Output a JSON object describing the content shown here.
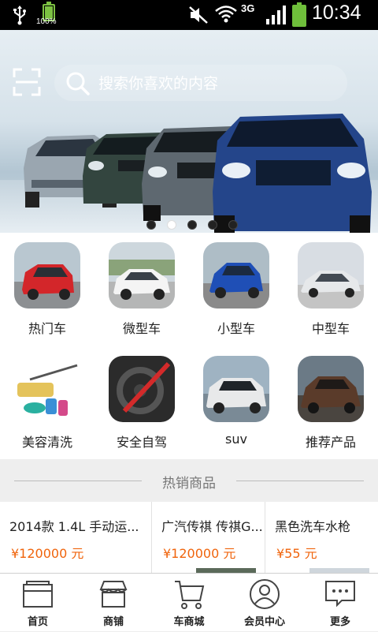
{
  "status_bar": {
    "battery_small_label": "100%",
    "network": "3G",
    "time": "10:34"
  },
  "banner": {
    "search_placeholder": "搜索你喜欢的内容",
    "pagination_total": 5,
    "pagination_active": 2
  },
  "categories": [
    {
      "label": "热门车"
    },
    {
      "label": "微型车"
    },
    {
      "label": "小型车"
    },
    {
      "label": "中型车"
    },
    {
      "label": "美容清洗"
    },
    {
      "label": "安全自驾"
    },
    {
      "label": "suv"
    },
    {
      "label": "推荐产品"
    }
  ],
  "hot_section": {
    "title": "热销商品",
    "products": [
      {
        "name": "2014款 1.4L 手动运...",
        "price": "¥120000 元"
      },
      {
        "name": "广汽传祺 传祺G...",
        "price": "¥120000 元"
      },
      {
        "name": "黑色洗车水枪",
        "price": "¥55 元"
      }
    ]
  },
  "tabbar": {
    "items": [
      {
        "label": "首页"
      },
      {
        "label": "商铺"
      },
      {
        "label": "车商城"
      },
      {
        "label": "会员中心"
      },
      {
        "label": "更多"
      }
    ]
  },
  "colors": {
    "price": "#f0640c",
    "statusbar_bg": "#000000",
    "battery": "#6fbf3b"
  }
}
